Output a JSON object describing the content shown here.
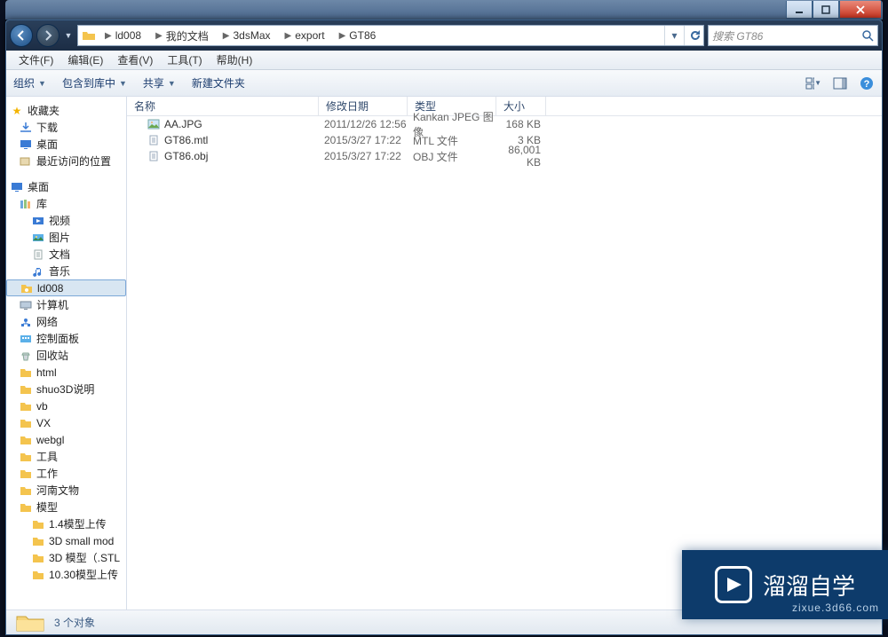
{
  "breadcrumb": [
    "ld008",
    "我的文档",
    "3dsMax",
    "export",
    "GT86"
  ],
  "search": {
    "placeholder": "搜索 GT86"
  },
  "menu": {
    "file": "文件(F)",
    "edit": "编辑(E)",
    "view": "查看(V)",
    "tools": "工具(T)",
    "help": "帮助(H)"
  },
  "toolbar": {
    "organize": "组织",
    "include": "包含到库中",
    "share": "共享",
    "newfolder": "新建文件夹"
  },
  "columns": {
    "name": "名称",
    "date": "修改日期",
    "type": "类型",
    "size": "大小"
  },
  "files": [
    {
      "icon": "img",
      "name": "AA.JPG",
      "date": "2011/12/26 12:56",
      "type": "Kankan JPEG 图像",
      "size": "168 KB"
    },
    {
      "icon": "doc",
      "name": "GT86.mtl",
      "date": "2015/3/27 17:22",
      "type": "MTL 文件",
      "size": "3 KB"
    },
    {
      "icon": "doc",
      "name": "GT86.obj",
      "date": "2015/3/27 17:22",
      "type": "OBJ 文件",
      "size": "86,001 KB"
    }
  ],
  "sidebar": {
    "fav_header": "收藏夹",
    "favs": [
      {
        "icon": "dl",
        "label": "下载"
      },
      {
        "icon": "desktop",
        "label": "桌面"
      },
      {
        "icon": "recent",
        "label": "最近访问的位置"
      }
    ],
    "desktop_header": "桌面",
    "library_header": "库",
    "library": [
      {
        "icon": "video",
        "label": "视频"
      },
      {
        "icon": "pic",
        "label": "图片"
      },
      {
        "icon": "doc",
        "label": "文档"
      },
      {
        "icon": "music",
        "label": "音乐"
      }
    ],
    "items": [
      {
        "icon": "folder-user",
        "label": "ld008",
        "selected": true
      },
      {
        "icon": "computer",
        "label": "计算机"
      },
      {
        "icon": "network",
        "label": "网络"
      },
      {
        "icon": "cpanel",
        "label": "控制面板"
      },
      {
        "icon": "recycle",
        "label": "回收站"
      },
      {
        "icon": "folder",
        "label": "html"
      },
      {
        "icon": "folder",
        "label": "shuo3D说明"
      },
      {
        "icon": "folder",
        "label": "vb"
      },
      {
        "icon": "folder",
        "label": "VX"
      },
      {
        "icon": "folder",
        "label": "webgl"
      },
      {
        "icon": "folder",
        "label": "工具"
      },
      {
        "icon": "folder",
        "label": "工作"
      },
      {
        "icon": "folder",
        "label": "河南文物"
      },
      {
        "icon": "folder",
        "label": "模型"
      }
    ],
    "subitems": [
      {
        "label": "1.4模型上传"
      },
      {
        "label": "3D small mod"
      },
      {
        "label": "3D 模型（.STL"
      },
      {
        "label": "10.30模型上传"
      }
    ]
  },
  "status": {
    "text": "3 个对象"
  },
  "watermark": {
    "title": "溜溜自学",
    "sub": "zixue.3d66.com"
  }
}
